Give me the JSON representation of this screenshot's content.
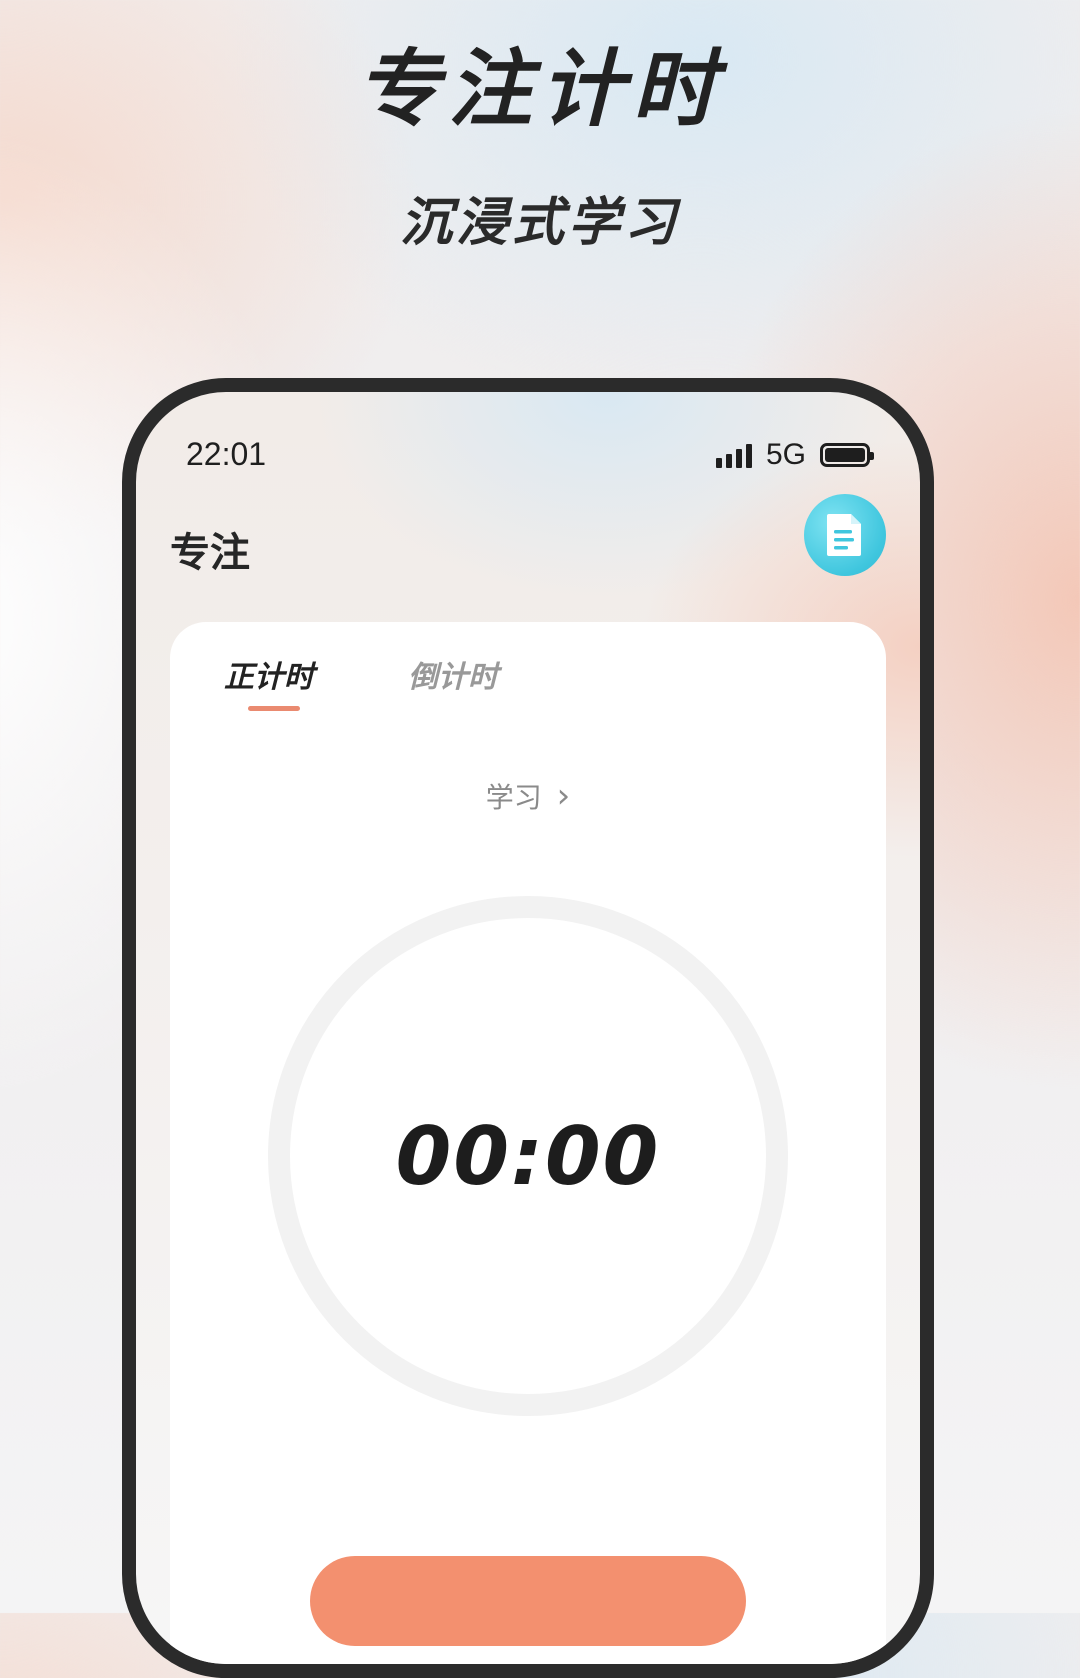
{
  "promo": {
    "headline": "专注计时",
    "subline": "沉浸式学习"
  },
  "status_bar": {
    "time": "22:01",
    "network": "5G",
    "signal_icon": "signal-bars-icon",
    "battery_icon": "battery-icon"
  },
  "header": {
    "title": "专注",
    "doc_icon": "document-icon"
  },
  "tabs": [
    {
      "label": "正计时",
      "active": true
    },
    {
      "label": "倒计时",
      "active": false
    }
  ],
  "category": {
    "label": "学习",
    "chevron": "›"
  },
  "timer": {
    "value": "00:00"
  },
  "colors": {
    "accent": "#ea8a70",
    "button": "#f3906f",
    "doc_button": "#3fc6de"
  }
}
